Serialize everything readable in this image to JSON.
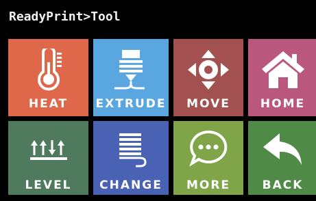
{
  "header": {
    "title": "ReadyPrint>Tool"
  },
  "tiles": [
    {
      "label": "HEAT",
      "icon": "thermometer-icon",
      "color": "#e0684a"
    },
    {
      "label": "EXTRUDE",
      "icon": "extruder-icon",
      "color": "#5aa6e0"
    },
    {
      "label": "MOVE",
      "icon": "move-icon",
      "color": "#a35050"
    },
    {
      "label": "HOME",
      "icon": "home-icon",
      "color": "#b9577d"
    },
    {
      "label": "LEVEL",
      "icon": "level-icon",
      "color": "#4f7a5e"
    },
    {
      "label": "CHANGE",
      "icon": "spool-icon",
      "color": "#4a62b4"
    },
    {
      "label": "MORE",
      "icon": "chat-bubble-icon",
      "color": "#7fa548"
    },
    {
      "label": "BACK",
      "icon": "back-arrow-icon",
      "color": "#4f8a46"
    }
  ]
}
